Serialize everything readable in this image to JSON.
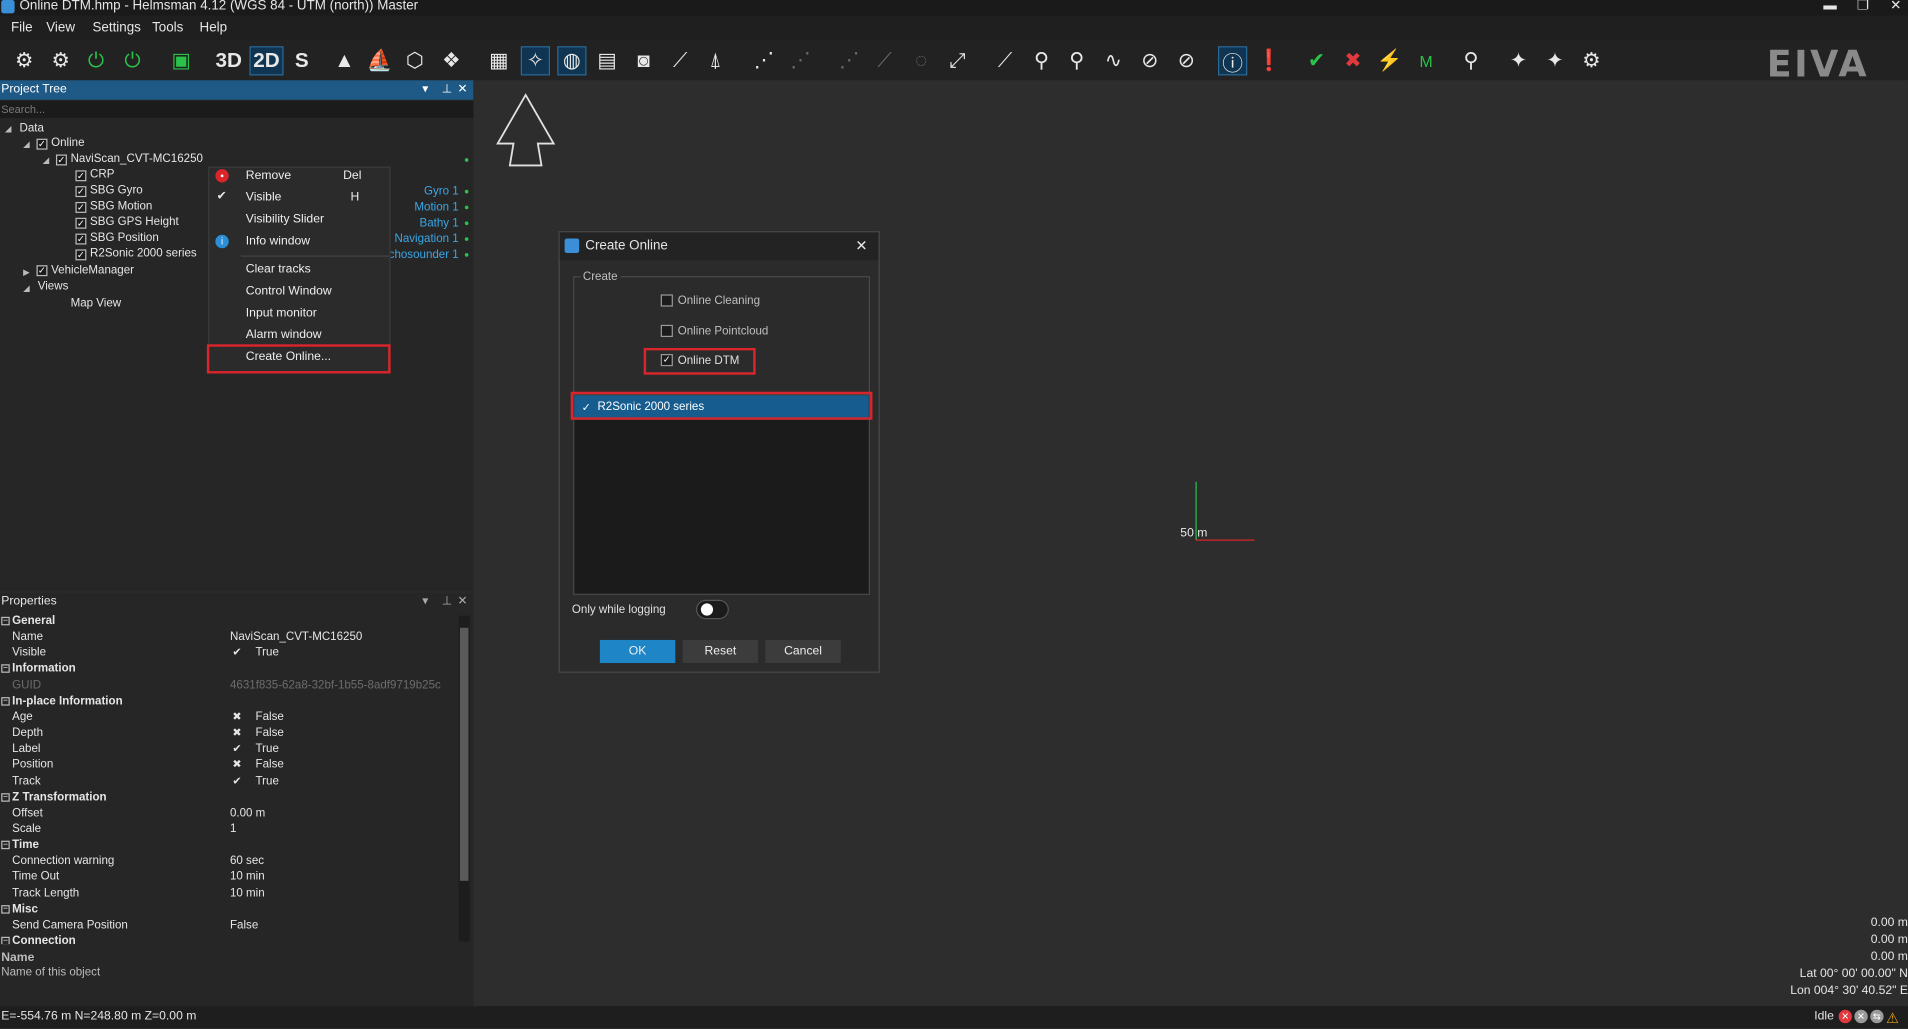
{
  "window": {
    "title": "Online DTM.hmp - Helmsman 4.12 (WGS 84 - UTM (north)) Master"
  },
  "menu": [
    "File",
    "View",
    "Settings",
    "Tools",
    "Help"
  ],
  "toolbar": {
    "mode_3d": "3D",
    "mode_2d": "2D",
    "mode_s": "S",
    "logo": "EIVA"
  },
  "project_tree": {
    "title": "Project Tree",
    "search_placeholder": "Search...",
    "data": "Data",
    "online": "Online",
    "naviscan": "NaviScan_CVT-MC16250",
    "items": [
      "CRP",
      "SBG Gyro",
      "SBG Motion",
      "SBG GPS Height",
      "SBG Position",
      "R2Sonic 2000 series"
    ],
    "signals": [
      "Gyro 1",
      "Motion 1",
      "Bathy 1",
      "Navigation 1",
      "chosounder 1"
    ],
    "vehicle_manager": "VehicleManager",
    "views": "Views",
    "map_view": "Map View"
  },
  "context_menu": {
    "remove": "Remove",
    "remove_sc": "Del",
    "visible": "Visible",
    "visible_sc": "H",
    "visibility_slider": "Visibility Slider",
    "info_window": "Info window",
    "clear_tracks": "Clear tracks",
    "control_window": "Control Window",
    "input_monitor": "Input monitor",
    "alarm_window": "Alarm window",
    "create_online": "Create Online..."
  },
  "properties": {
    "title": "Properties",
    "rows": [
      {
        "type": "sec",
        "k": "General"
      },
      {
        "k": "Name",
        "v": "NaviScan_CVT-MC16250"
      },
      {
        "k": "Visible",
        "mark": "✔",
        "v": "True"
      },
      {
        "type": "sec",
        "k": "Information"
      },
      {
        "k": "GUID",
        "v": "4631f835-62a8-32bf-1b55-8adf9719b25c",
        "dim": true
      },
      {
        "type": "sec",
        "k": "In-place Information"
      },
      {
        "k": "Age",
        "mark": "✖",
        "v": "False"
      },
      {
        "k": "Depth",
        "mark": "✖",
        "v": "False"
      },
      {
        "k": "Label",
        "mark": "✔",
        "v": "True"
      },
      {
        "k": "Position",
        "mark": "✖",
        "v": "False"
      },
      {
        "k": "Track",
        "mark": "✔",
        "v": "True"
      },
      {
        "type": "sec",
        "k": "Z Transformation"
      },
      {
        "k": "Offset",
        "v": "0.00 m"
      },
      {
        "k": "Scale",
        "v": "1"
      },
      {
        "type": "sec",
        "k": "Time"
      },
      {
        "k": "Connection warning",
        "v": "60 sec"
      },
      {
        "k": "Time Out",
        "v": "10 min"
      },
      {
        "k": "Track Length",
        "v": "10 min"
      },
      {
        "type": "sec",
        "k": "Misc"
      },
      {
        "k": "Send Camera Position",
        "v": "False"
      },
      {
        "type": "sec",
        "k": "Connection"
      }
    ],
    "desc_title": "Name",
    "desc_text": "Name of this object"
  },
  "dialog": {
    "title": "Create Online",
    "group": "Create",
    "online_cleaning": "Online Cleaning",
    "online_pointcloud": "Online Pointcloud",
    "online_dtm": "Online DTM",
    "list_item": "R2Sonic 2000 series",
    "only_while_logging": "Only while logging",
    "ok": "OK",
    "reset": "Reset",
    "cancel": "Cancel"
  },
  "viewport": {
    "scale": "50 m",
    "readout": [
      "0.00 m",
      "0.00 m",
      "0.00 m",
      "Lat 00° 00' 00.00\" N",
      "Lon 004° 30' 40.52\" E"
    ]
  },
  "status": {
    "coords": "E=-554.76 m N=248.80 m Z=0.00 m",
    "state": "Idle"
  },
  "colors": {
    "accent": "#1f5a86",
    "highlight": "#d9252b",
    "selection": "#165c8e",
    "ok": "#1e86c7"
  }
}
